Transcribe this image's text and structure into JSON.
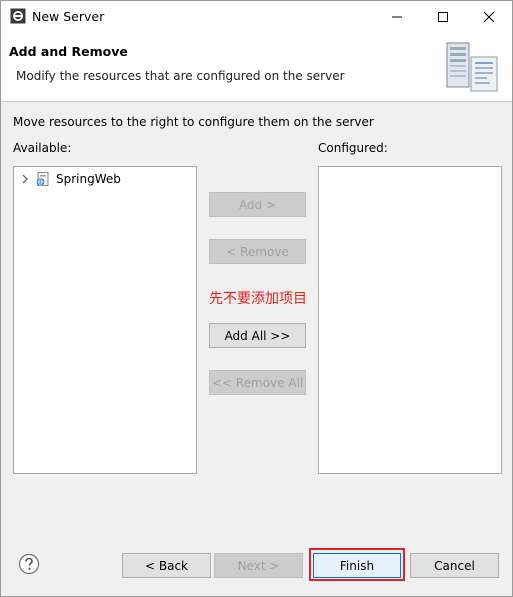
{
  "window": {
    "title": "New Server"
  },
  "header": {
    "title": "Add and Remove",
    "description": "Modify the resources that are configured on the server"
  },
  "body": {
    "instruction": "Move resources to the right to configure them on the server",
    "available_label": "Available:",
    "configured_label": "Configured:",
    "available_items": [
      {
        "label": "SpringWeb"
      }
    ],
    "configured_items": [],
    "buttons": {
      "add": "Add >",
      "remove": "< Remove",
      "add_all": "Add All >>",
      "remove_all": "<< Remove All"
    },
    "annotation": "先不要添加项目"
  },
  "footer": {
    "back": "< Back",
    "next": "Next >",
    "finish": "Finish",
    "cancel": "Cancel"
  },
  "colors": {
    "annotation": "#e8201c",
    "highlight_box": "#e1202a",
    "focus_border": "#0078d7"
  }
}
